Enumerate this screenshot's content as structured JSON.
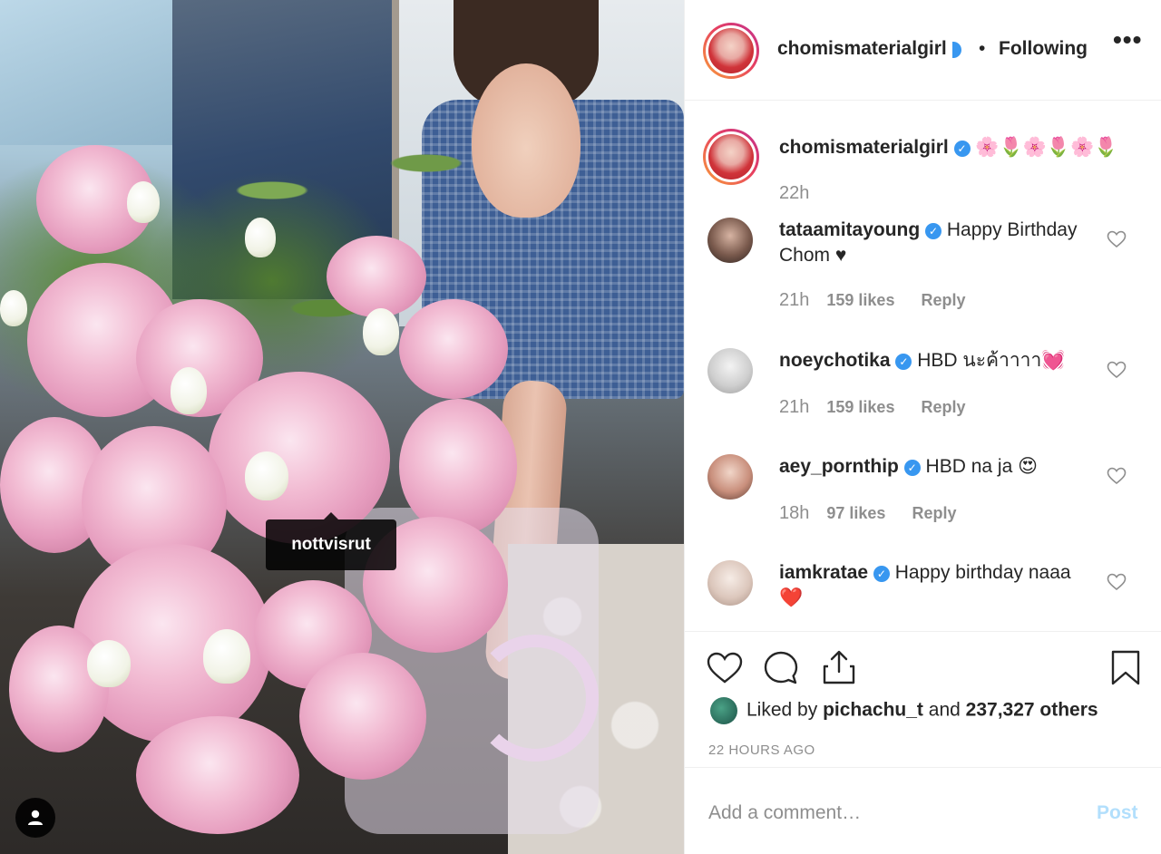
{
  "post": {
    "photo_tag": "nottvisrut",
    "author": "chomismaterialgirl",
    "following_label": "Following",
    "more_label": "•••"
  },
  "caption": {
    "username": "chomismaterialgirl",
    "text": "🌸🌷🌸🌷🌸🌷",
    "time": "22h"
  },
  "comments": [
    {
      "username": "tataamitayoung",
      "text": "Happy Birthday Chom ♥",
      "time": "21h",
      "likes": "159 likes",
      "reply": "Reply"
    },
    {
      "username": "noeychotika",
      "text": "HBD นะค้าาาา💓",
      "time": "21h",
      "likes": "159 likes",
      "reply": "Reply"
    },
    {
      "username": "aey_pornthip",
      "text": "HBD na ja 😍",
      "time": "18h",
      "likes": "97 likes",
      "reply": "Reply"
    },
    {
      "username": "iamkratae",
      "text": "Happy birthday naaa❤️",
      "time": "",
      "likes": "",
      "reply": ""
    }
  ],
  "likes": {
    "prefix": "Liked by",
    "user": "pichachu_t",
    "joiner": "and",
    "others": "237,327 others"
  },
  "timestamp": "22 HOURS AGO",
  "add_comment": {
    "placeholder": "Add a comment…",
    "post_label": "Post"
  },
  "colors": {
    "verified": "#3897f0",
    "muted": "#8e8e8e",
    "post_disabled": "#b2dffc"
  }
}
